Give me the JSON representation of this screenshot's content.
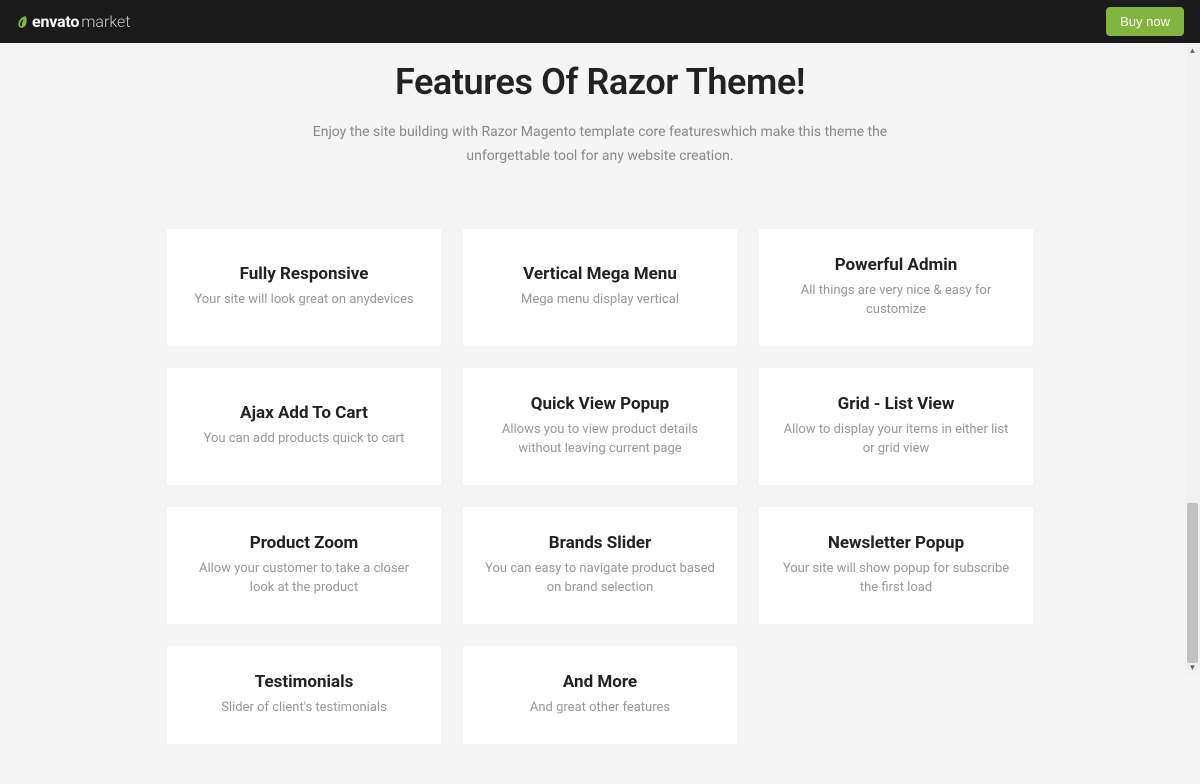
{
  "topbar": {
    "logo_prefix": "envato",
    "logo_suffix": "market",
    "buy_label": "Buy now"
  },
  "heading": {
    "title": "Features Of Razor Theme!",
    "subtitle": "Enjoy the site building with Razor Magento template core featureswhich make this theme the unforgettable tool for any website creation."
  },
  "features": [
    {
      "title": "Fully Responsive",
      "desc": "Your site will look great on anydevices"
    },
    {
      "title": "Vertical Mega Menu",
      "desc": "Mega menu display vertical"
    },
    {
      "title": "Powerful Admin",
      "desc": "All things are very nice & easy for customize"
    },
    {
      "title": "Ajax Add To Cart",
      "desc": "You can add products quick to cart"
    },
    {
      "title": "Quick View Popup",
      "desc": "Allows you to view product details without leaving current page"
    },
    {
      "title": "Grid - List View",
      "desc": "Allow to display your items in either list or grid view"
    },
    {
      "title": "Product Zoom",
      "desc": "Allow your customer to take a closer look at the product"
    },
    {
      "title": "Brands Slider",
      "desc": "You can easy to navigate product based on brand selection"
    },
    {
      "title": "Newsletter Popup",
      "desc": "Your site will show popup for subscribe the first load"
    },
    {
      "title": "Testimonials",
      "desc": "Slider of client's testimonials"
    },
    {
      "title": "And More",
      "desc": "And great other features"
    }
  ]
}
